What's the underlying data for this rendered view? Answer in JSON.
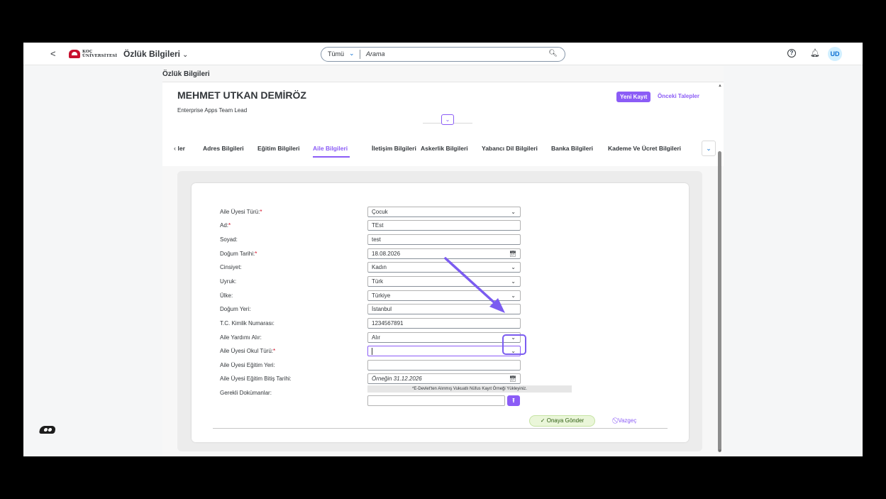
{
  "shellbar": {
    "back": "<",
    "logo_text_1": "KOÇ",
    "logo_text_2": "ÜNİVERSİTESİ",
    "app_title": "Özlük Bilgileri",
    "app_title_chevron": "⌄",
    "search_scope": "Tümü",
    "search_placeholder": "Arama",
    "user_initials": "UD",
    "help": "?"
  },
  "page": {
    "title": "Özlük Bilgileri",
    "person_name": "MEHMET UTKAN DEMİRÖZ",
    "person_role": "Enterprise Apps Team Lead",
    "new_record_button": "Yeni Kayıt",
    "previous_requests_button": "Önceki Talepler"
  },
  "tabs": {
    "truncated_left": "ler",
    "items": [
      {
        "label": "Adres Bilgileri"
      },
      {
        "label": "Eğitim Bilgileri"
      },
      {
        "label": "Aile Bilgileri"
      },
      {
        "label": "İletişim Bilgileri"
      },
      {
        "label": "Askerlik Bilgileri"
      },
      {
        "label": "Yabancı Dil Bilgileri"
      },
      {
        "label": "Banka Bilgileri"
      },
      {
        "label": "Kademe Ve Ücret Bilgileri"
      }
    ],
    "active": "Aile Bilgileri"
  },
  "form": {
    "fields": [
      {
        "label": "Aile Üyesi Türü:",
        "required": "*",
        "value": "Çocuk",
        "type": "select"
      },
      {
        "label": "Ad:",
        "required": "*",
        "value": "TEst",
        "type": "text"
      },
      {
        "label": "Soyad:",
        "required": "",
        "value": "test",
        "type": "text"
      },
      {
        "label": "Doğum Tarihi:",
        "required": "*",
        "value": "18.08.2026",
        "type": "date"
      },
      {
        "label": "Cinsiyet:",
        "required": "",
        "value": "Kadın",
        "type": "select"
      },
      {
        "label": "Uyruk:",
        "required": "",
        "value": "Türk",
        "type": "select"
      },
      {
        "label": "Ülke:",
        "required": "",
        "value": "Türkiye",
        "type": "select"
      },
      {
        "label": "Doğum Yeri:",
        "required": "",
        "value": "İstanbul",
        "type": "text"
      },
      {
        "label": "T.C. Kimlik Numarası:",
        "required": "",
        "value": "1234567891",
        "type": "text"
      },
      {
        "label": "Aile Yardımı Alır:",
        "required": "",
        "value": "Alır",
        "type": "select"
      },
      {
        "label": "Aile Üyesi Okul Türü:",
        "required": "*",
        "value": "",
        "type": "select"
      },
      {
        "label": "Aile Üyesi Eğitim Yeri:",
        "required": "",
        "value": "",
        "type": "text"
      },
      {
        "label": "Aile Üyesi Eğitim Bitiş Tarihi:",
        "required": "",
        "value": "",
        "placeholder": "Örneğin 31.12.2026",
        "type": "date"
      }
    ],
    "documents_label": "Gerekli Dokümanlar:",
    "documents_notice": "*E-Devlet'ten Alınmış Vukuatlı Nüfus Kayıt Örneği Yükleyiniz.",
    "submit_button": "Onaya Gönder",
    "cancel_button": "Vazgeç"
  },
  "colors": {
    "accent": "#8b5cf6",
    "annotation": "#7b5cf0",
    "required": "#d0021b"
  }
}
